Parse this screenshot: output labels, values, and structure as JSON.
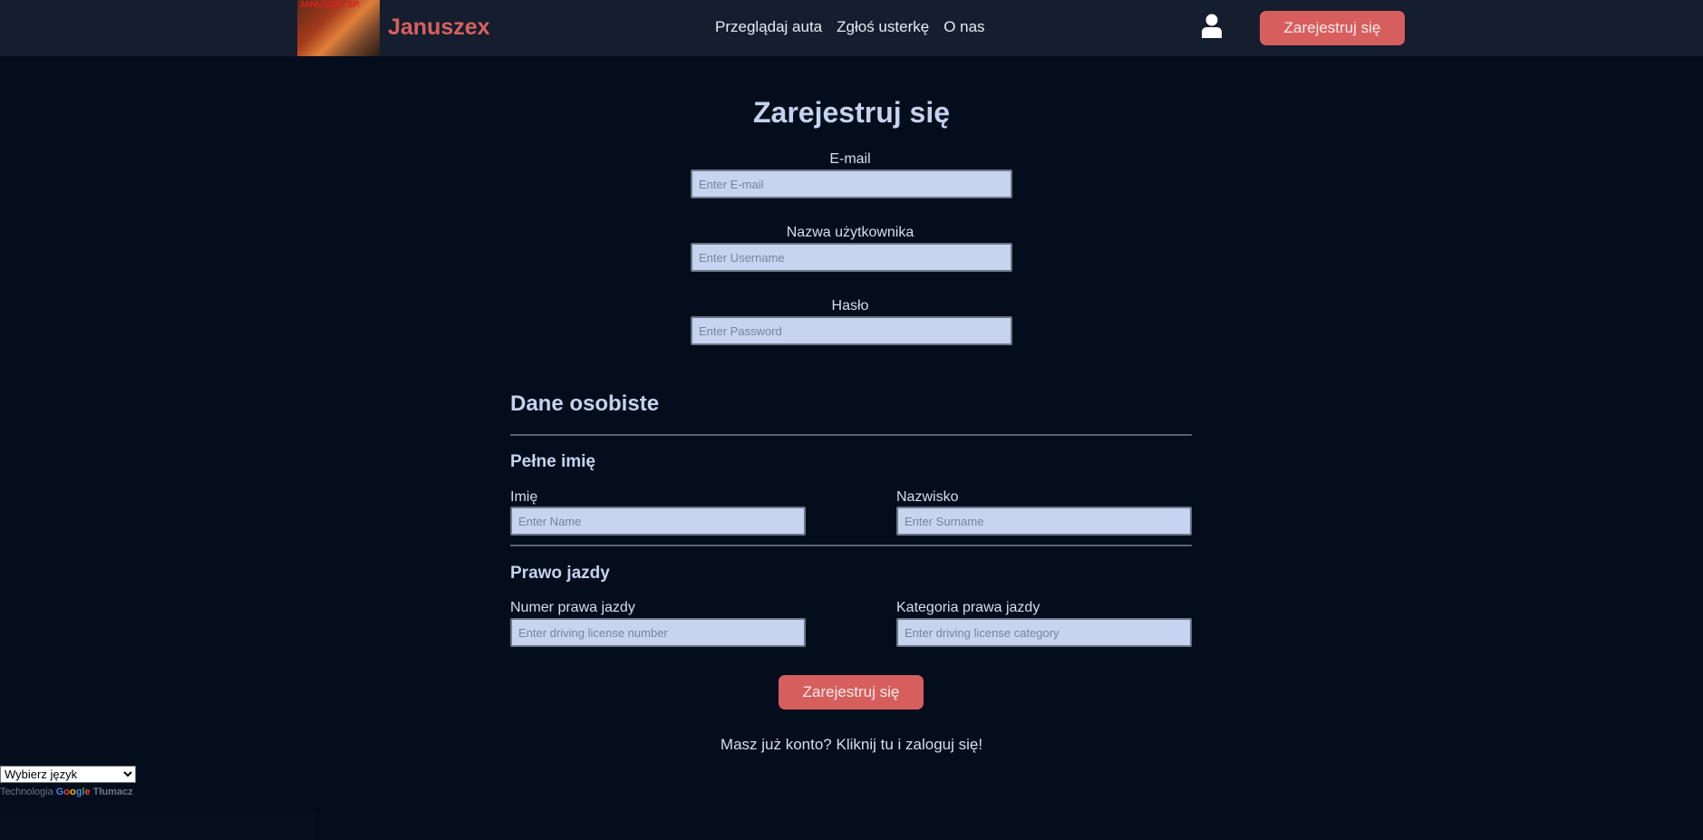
{
  "header": {
    "logo_text": "JANUSZEX SP.",
    "brand": "Januszex",
    "nav": [
      "Przeglądaj auta",
      "Zgłoś usterkę",
      "O nas"
    ],
    "register_button": "Zarejestruj się"
  },
  "form": {
    "title": "Zarejestruj się",
    "email": {
      "label": "E-mail",
      "placeholder": "Enter E-mail",
      "value": ""
    },
    "username": {
      "label": "Nazwa użytkownika",
      "placeholder": "Enter Username",
      "value": ""
    },
    "password": {
      "label": "Hasło",
      "placeholder": "Enter Password",
      "value": ""
    },
    "personal": {
      "heading": "Dane osobiste",
      "fullname_heading": "Pełne imię",
      "name": {
        "label": "Imię",
        "placeholder": "Enter Name",
        "value": ""
      },
      "surname": {
        "label": "Nazwisko",
        "placeholder": "Enter Surname",
        "value": ""
      },
      "license_heading": "Prawo jazdy",
      "license_number": {
        "label": "Numer prawa jazdy",
        "placeholder": "Enter driving license number",
        "value": ""
      },
      "license_category": {
        "label": "Kategoria prawa jazdy",
        "placeholder": "Enter driving license category",
        "value": ""
      }
    },
    "submit": "Zarejestruj się",
    "login_link": "Masz już konto? Kliknij tu i zaloguj się!"
  },
  "translate": {
    "select_value": "Wybierz język",
    "credit_prefix": "Technologia",
    "credit_suffix": "Tłumacz"
  },
  "colors": {
    "background": "#030d1c",
    "topbar": "#141e2e",
    "accent": "#d65f5e",
    "input_bg": "#c7d3ef"
  },
  "icons": {
    "user": "user-icon"
  }
}
